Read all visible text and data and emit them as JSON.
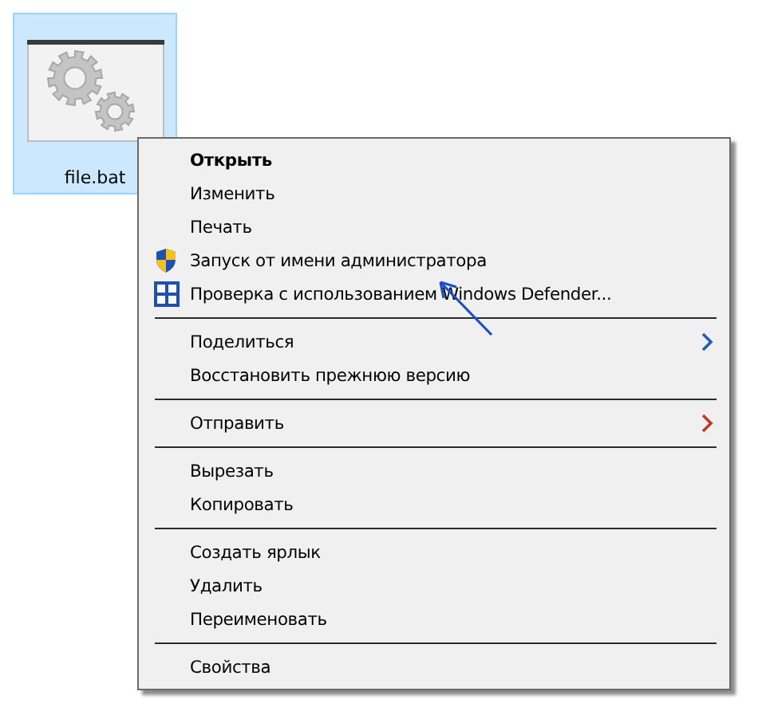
{
  "file": {
    "name": "file.bat",
    "selected": true
  },
  "menu": {
    "groups": [
      {
        "items": [
          {
            "label": "Открыть",
            "bold": true,
            "kind": "plain"
          },
          {
            "label": "Изменить",
            "bold": false,
            "kind": "plain"
          },
          {
            "label": "Печать",
            "bold": false,
            "kind": "plain"
          },
          {
            "label": "Запуск от имени администратора",
            "bold": false,
            "kind": "shield"
          },
          {
            "label": "Проверка с использованием Windows Defender...",
            "bold": false,
            "kind": "defender"
          }
        ]
      },
      {
        "items": [
          {
            "label": "Поделиться",
            "bold": false,
            "kind": "plain",
            "submenu": true,
            "color": "#1e5fb3"
          },
          {
            "label": "Восстановить прежнюю версию",
            "bold": false,
            "kind": "plain"
          }
        ]
      },
      {
        "items": [
          {
            "label": "Отправить",
            "bold": false,
            "kind": "plain",
            "submenu": true,
            "color": "#c0392b"
          }
        ]
      },
      {
        "items": [
          {
            "label": "Вырезать",
            "bold": false,
            "kind": "plain"
          },
          {
            "label": "Копировать",
            "bold": false,
            "kind": "plain"
          }
        ]
      },
      {
        "items": [
          {
            "label": "Создать ярлык",
            "bold": false,
            "kind": "plain"
          },
          {
            "label": "Удалить",
            "bold": false,
            "kind": "plain"
          },
          {
            "label": "Переименовать",
            "bold": false,
            "kind": "plain"
          }
        ]
      },
      {
        "items": [
          {
            "label": "Свойства",
            "bold": false,
            "kind": "plain"
          }
        ]
      }
    ]
  }
}
